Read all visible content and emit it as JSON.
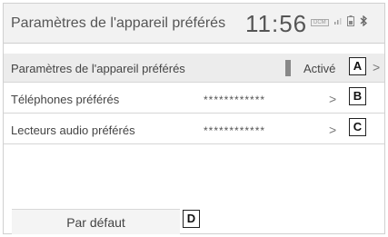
{
  "header": {
    "title": "Paramètres de l'appareil préférés",
    "clock": "11:56",
    "dcm_label": "DCM"
  },
  "rows": [
    {
      "label": "Paramètres de l'appareil préférés",
      "value": "Activé",
      "chevron": ">",
      "callout": "A"
    },
    {
      "label": "Téléphones préférés",
      "value": "************",
      "chevron": ">",
      "callout": "B"
    },
    {
      "label": "Lecteurs audio préférés",
      "value": "************",
      "chevron": ">",
      "callout": "C"
    }
  ],
  "footer": {
    "default_button": "Par défaut",
    "callout": "D"
  }
}
